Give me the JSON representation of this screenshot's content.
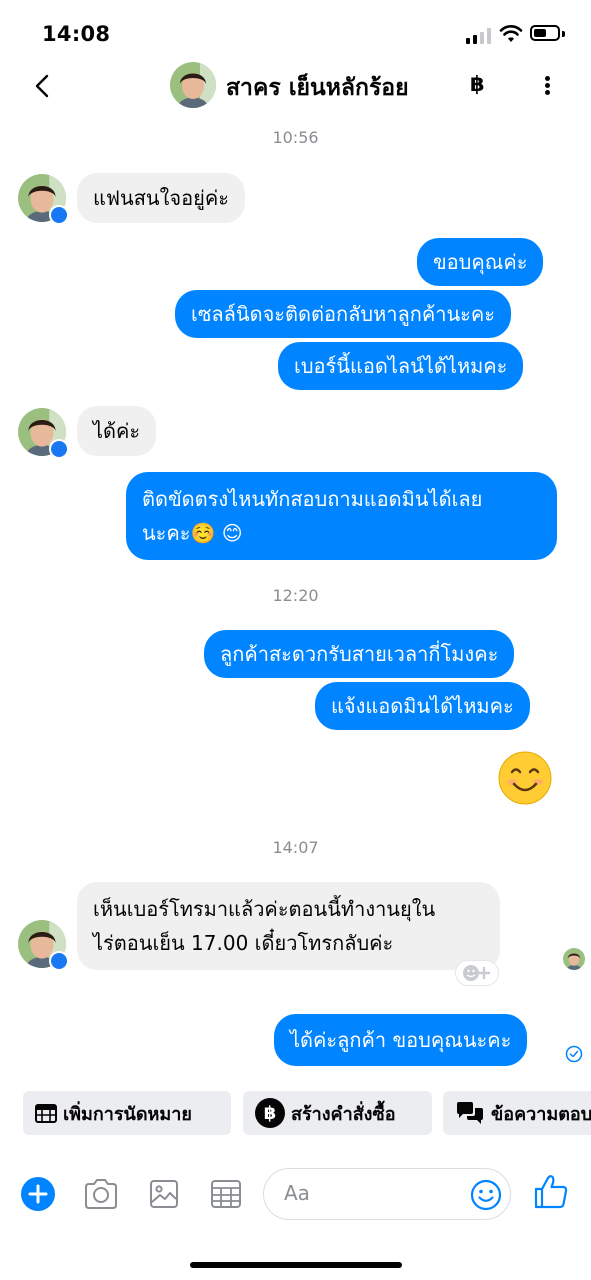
{
  "status_bar": {
    "time": "14:08",
    "battery_level": 0.55
  },
  "header": {
    "contact_name": "สาคร เย็นหลักร้อย",
    "currency_symbol": "฿"
  },
  "timestamps": [
    "10:56",
    "12:20",
    "14:07"
  ],
  "messages": {
    "m1": "แฟนสนใจอยู่ค่ะ",
    "m2": "ขอบคุณค่ะ",
    "m3": "เซลล์นิดจะติดต่อกลับหาลูกค้านะคะ",
    "m4": "เบอร์นี้แอดไลน์ได้ไหมคะ",
    "m5": "ได้ค่ะ",
    "m6_line1": "ติดขัดตรงไหนทักสอบถามแอดมินได้เลย",
    "m6_line2": "นะคะ",
    "m6_emoji": "☺️ 😊",
    "m7": "ลูกค้าสะดวกรับสายเวลากี่โมงคะ",
    "m8": "แจ้งแอดมินได้ไหมคะ",
    "m9_emoji": "😊",
    "m10_line1": "เห็นเบอร์โทรมาแล้วค่ะตอนนี้ทำงานยุใน",
    "m10_line2": "ไร่ตอนเย็น 17.00 เดี๋ยวโทรกลับค่ะ",
    "m11": "ได้ค่ะลูกค้า ขอบคุณนะคะ"
  },
  "quick_replies": {
    "appointment": "เพิ่มการนัดหมาย",
    "order": "สร้างคำสั่งซื้อ",
    "order_icon": "฿",
    "saved": "ข้อความตอบกลับ"
  },
  "composer": {
    "placeholder": "Aa"
  },
  "colors": {
    "accent": "#0084ff",
    "incoming": "#f0f0f0",
    "timestamp": "#8a8d91"
  },
  "icons": [
    "back-chevron-icon",
    "baht-icon",
    "more-vertical-icon",
    "messenger-badge-icon",
    "add-icon",
    "camera-icon",
    "image-icon",
    "calendar-icon",
    "emoji-icon",
    "like-icon",
    "reaction-add-icon",
    "sent-check-icon"
  ]
}
